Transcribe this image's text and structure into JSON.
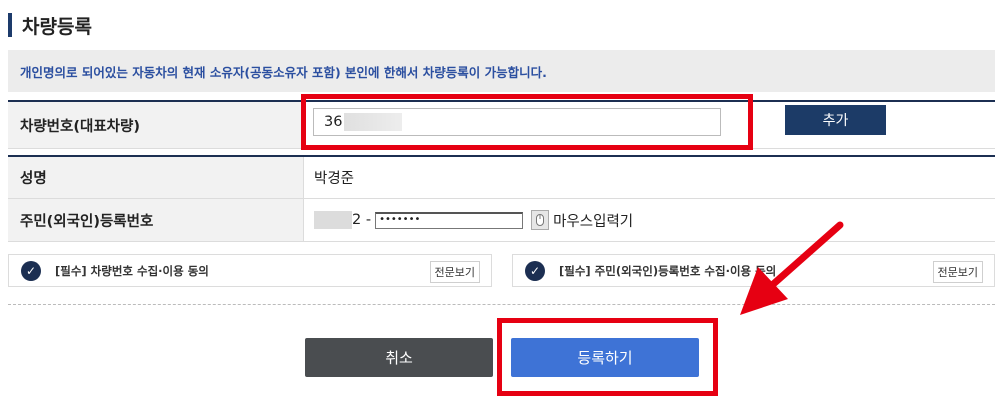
{
  "page": {
    "title": "차량등록",
    "notice": "개인명의로 되어있는 자동차의 현재 소유자(공동소유자 포함) 본인에 한해서 차량등록이 가능합니다."
  },
  "vehicle": {
    "label": "차량번호(대표차량)",
    "value_prefix": "36",
    "add_label": "추가"
  },
  "owner": {
    "name_label": "성명",
    "name_value": "박경준",
    "id_label": "주민(외국인)등록번호",
    "id_visible_suffix": "2 -",
    "password_mask": "•••••••",
    "mouse_input_label": "마우스입력기"
  },
  "consents": [
    {
      "label": "[필수] 차량번호 수집·이용 동의",
      "view_label": "전문보기",
      "checked": true
    },
    {
      "label": "[필수] 주민(외국인)등록번호 수집·이용 동의",
      "view_label": "전문보기",
      "checked": true
    }
  ],
  "actions": {
    "cancel_label": "취소",
    "register_label": "등록하기"
  },
  "colors": {
    "highlight": "#e60012",
    "navy": "#1c3b67",
    "register_blue": "#3e73d6",
    "cancel_gray": "#4a4d50"
  },
  "icons": {
    "check": "check-circle-icon",
    "mouse": "mouse-icon",
    "arrow": "red-arrow-icon"
  }
}
